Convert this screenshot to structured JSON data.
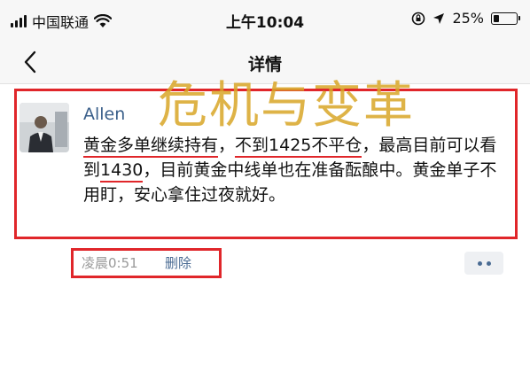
{
  "status_bar": {
    "carrier": "中国联通",
    "time": "上午10:04",
    "battery": "25%",
    "battery_level": 0.25
  },
  "nav": {
    "title": "详情"
  },
  "watermark": "危机与变革",
  "post": {
    "author": "Allen",
    "segments": [
      {
        "text": "黄金多单继续持有",
        "underline": true
      },
      {
        "text": "，",
        "underline": false
      },
      {
        "text": "不到1425不平仓",
        "underline": true
      },
      {
        "text": "，最高目前可以看到",
        "underline": false
      },
      {
        "text": "1430",
        "underline": true
      },
      {
        "text": "，目前黄金中线单也在准备酝酿中。黄金单子不用盯，安心拿住过夜就好。",
        "underline": false
      }
    ],
    "time": "凌晨0:51",
    "delete_label": "删除"
  },
  "colors": {
    "highlight_border": "#e0262a",
    "link": "#4a6b93",
    "watermark": "#d9a628"
  }
}
